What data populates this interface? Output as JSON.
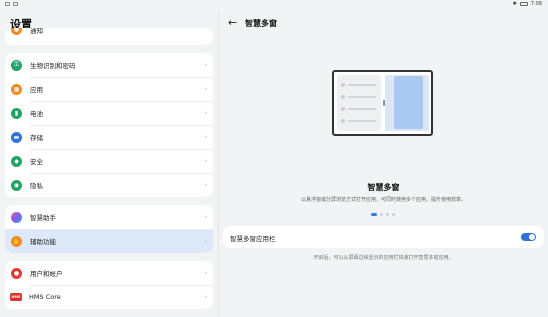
{
  "status_bar": {
    "time": "7:08"
  },
  "settings": {
    "title": "设置",
    "group1": [
      {
        "label": "通知",
        "icon": "bell-icon",
        "color": "#f08a24"
      }
    ],
    "group2": [
      {
        "label": "生物识别和密码",
        "icon": "key-icon",
        "color": "#21a366"
      },
      {
        "label": "应用",
        "icon": "apps-icon",
        "color": "#f08a24"
      },
      {
        "label": "电池",
        "icon": "battery-icon",
        "color": "#21a366"
      },
      {
        "label": "存储",
        "icon": "storage-icon",
        "color": "#2f74d6"
      },
      {
        "label": "安全",
        "icon": "shield-icon",
        "color": "#21a366"
      },
      {
        "label": "隐私",
        "icon": "privacy-icon",
        "color": "#21a366"
      }
    ],
    "group3": [
      {
        "label": "智慧助手",
        "icon": "assistant-icon",
        "color": "#a05fd8"
      },
      {
        "label": "辅助功能",
        "icon": "accessibility-icon",
        "color": "#f08a24",
        "selected": true
      }
    ],
    "group4": [
      {
        "label": "用户和帐户",
        "icon": "user-icon",
        "color": "#e53935"
      },
      {
        "label": "HMS Core",
        "icon": "hms-core-icon",
        "color": "#d9342b"
      }
    ]
  },
  "detail": {
    "title": "智慧多窗",
    "feature_title": "智慧多窗",
    "feature_desc": "以悬浮窗或分屏浏览方式打开应用，可同时使用多个应用，提升使用效率。",
    "toggle_label": "智慧多窗应用栏",
    "toggle_on": true,
    "toggle_desc": "开启后，可以从屏幕边缘显示的应用栏快速打开智慧多窗应用。",
    "pager_total": 4,
    "pager_active": 1
  }
}
